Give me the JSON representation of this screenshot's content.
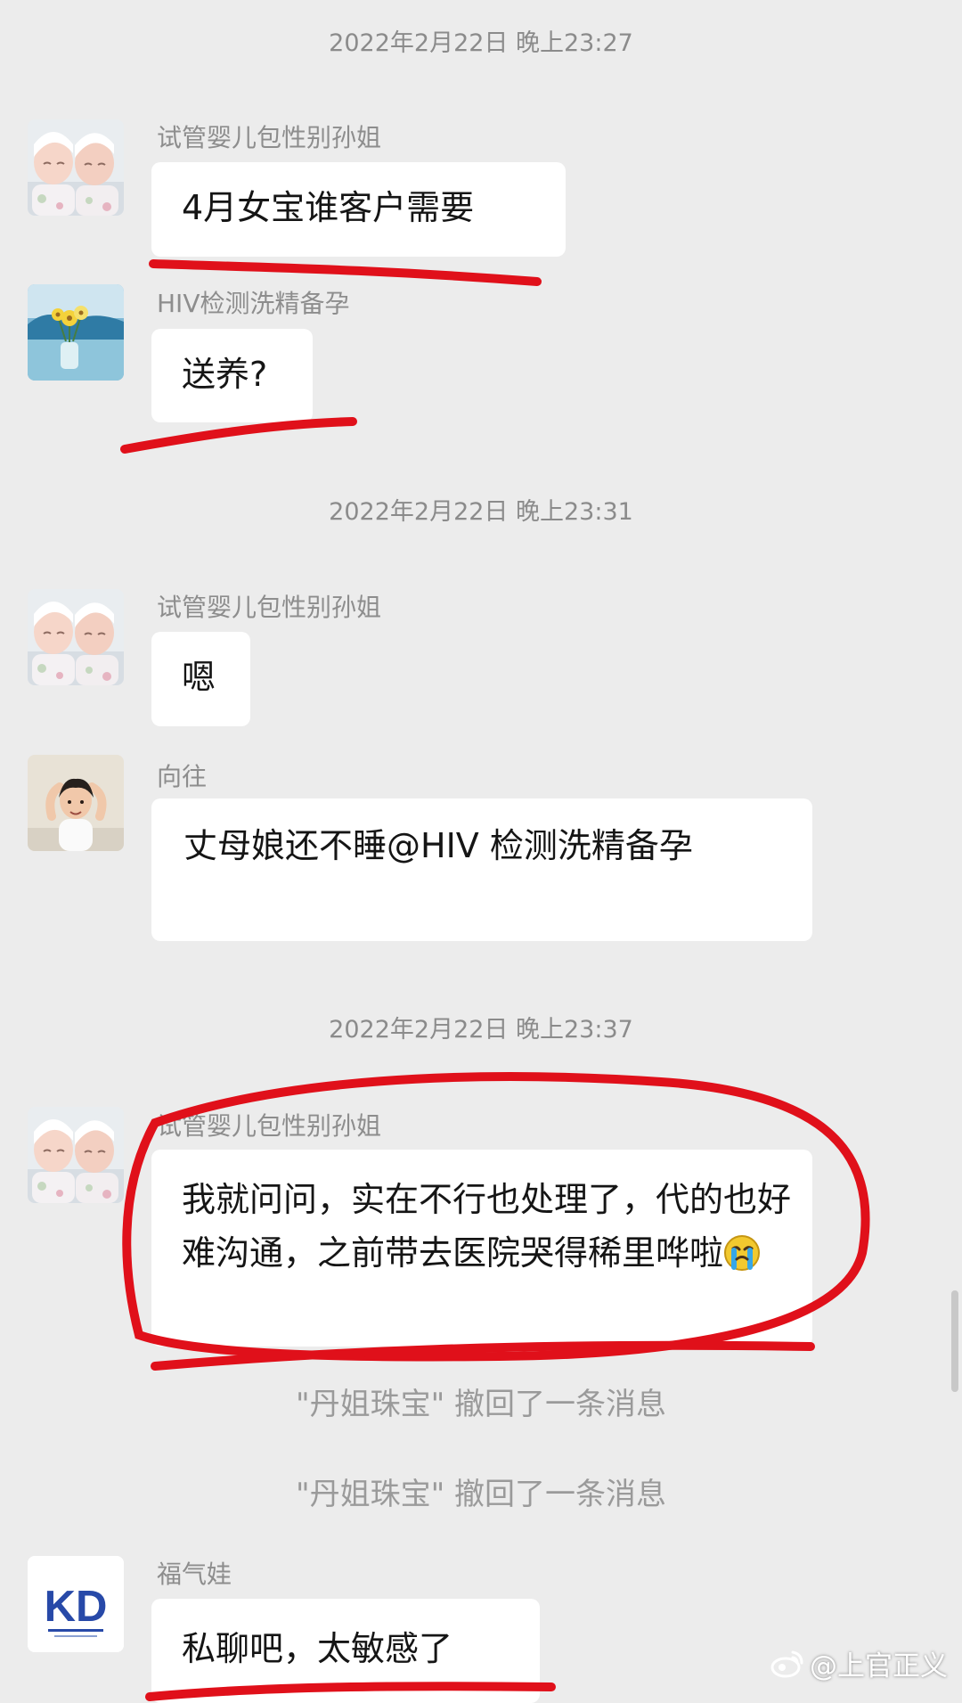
{
  "timestamps": [
    "2022年2月22日 晚上23:27",
    "2022年2月22日 晚上23:31",
    "2022年2月22日 晚上23:37"
  ],
  "messages": [
    {
      "sender": "试管婴儿包性别孙姐",
      "avatar": "twin-babies-avatar",
      "text": "4月女宝谁客户需要"
    },
    {
      "sender": "HIV检测洗精备孕",
      "avatar": "flower-landscape-avatar",
      "text": "送养?"
    },
    {
      "sender": "试管婴儿包性别孙姐",
      "avatar": "twin-babies-avatar",
      "text": "嗯"
    },
    {
      "sender": "向往",
      "avatar": "child-photo-avatar",
      "text": "丈母娘还不睡@HIV 检测洗精备孕"
    },
    {
      "sender": "试管婴儿包性别孙姐",
      "avatar": "twin-babies-avatar",
      "text": "我就问问，实在不行也处理了，代的也好难沟通，之前带去医院哭得稀里哗啦",
      "emoji": "crying-face-emoji"
    },
    {
      "sender": "福气娃",
      "avatar": "kd-logo-avatar",
      "avatar_text": "KD",
      "text": "私聊吧，太敏感了"
    }
  ],
  "system_notices": [
    "\"丹姐珠宝\" 撤回了一条消息",
    "\"丹姐珠宝\" 撤回了一条消息"
  ],
  "watermark": {
    "icon": "weibo-icon",
    "text": "@上官正义"
  },
  "colors": {
    "background": "#ececec",
    "bubble": "#ffffff",
    "annotation": "#e0101a",
    "meta_text": "#8b8b8b",
    "message_text": "#151515"
  }
}
